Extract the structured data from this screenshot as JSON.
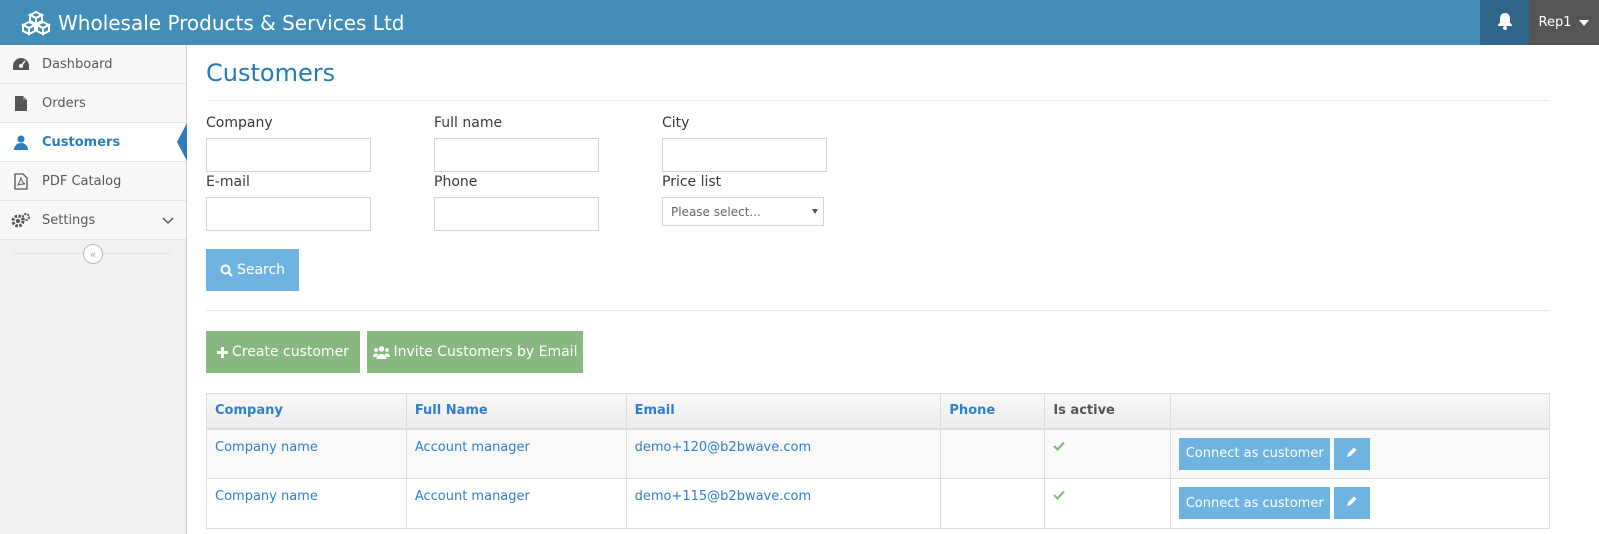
{
  "app": {
    "title": "Wholesale Products & Services Ltd"
  },
  "header": {
    "user": "Rep1"
  },
  "sidebar": {
    "items": [
      {
        "label": "Dashboard",
        "icon": "dashboard-icon"
      },
      {
        "label": "Orders",
        "icon": "file-icon"
      },
      {
        "label": "Customers",
        "icon": "user-icon",
        "active": true
      },
      {
        "label": "PDF Catalog",
        "icon": "pdf-icon"
      },
      {
        "label": "Settings",
        "icon": "gears-icon"
      }
    ]
  },
  "page": {
    "title": "Customers"
  },
  "filters": {
    "company_label": "Company",
    "fullname_label": "Full name",
    "city_label": "City",
    "email_label": "E-mail",
    "phone_label": "Phone",
    "pricelist_label": "Price list",
    "pricelist_selected": "Please select...",
    "company_value": "",
    "fullname_value": "",
    "city_value": "",
    "email_value": "",
    "phone_value": ""
  },
  "buttons": {
    "search": "Search",
    "create": "Create customer",
    "invite": "Invite Customers by Email",
    "connect": "Connect as customer"
  },
  "table": {
    "headers": [
      "Company",
      "Full Name",
      "Email",
      "Phone",
      "Is active",
      ""
    ],
    "rows": [
      {
        "company": "Company name",
        "full_name": "Account manager",
        "email": "demo+120@b2bwave.com",
        "phone": "",
        "active": true
      },
      {
        "company": "Company name",
        "full_name": "Account manager",
        "email": "demo+115@b2bwave.com",
        "phone": "",
        "active": true
      }
    ]
  },
  "colors": {
    "navbar": "#438eb9",
    "primary": "#6fb3e0",
    "success": "#87b87f",
    "title": "#2679b5"
  }
}
